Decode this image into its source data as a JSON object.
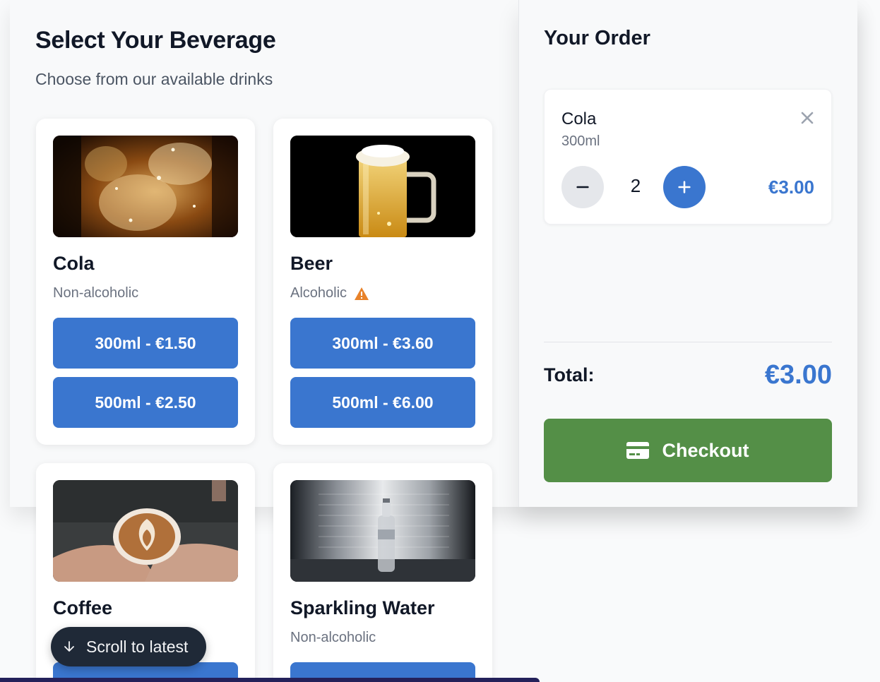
{
  "header": {
    "title": "Select Your Beverage",
    "subtitle": "Choose from our available drinks"
  },
  "beverages": [
    {
      "name": "Cola",
      "type": "Non-alcoholic",
      "options": [
        "300ml - €1.50",
        "500ml - €2.50"
      ],
      "image": "cola-photo"
    },
    {
      "name": "Beer",
      "type": "Alcoholic",
      "warning_icon": "warning-triangle-icon",
      "options": [
        "300ml - €3.60",
        "500ml - €6.00"
      ],
      "image": "beer-photo"
    },
    {
      "name": "Coffee",
      "image": "coffee-photo"
    },
    {
      "name": "Sparkling Water",
      "type": "Non-alcoholic",
      "image": "water-photo"
    }
  ],
  "order": {
    "title": "Your Order",
    "items": [
      {
        "name": "Cola",
        "size": "300ml",
        "quantity": "2",
        "price": "€3.00"
      }
    ],
    "total_label": "Total:",
    "total_value": "€3.00",
    "checkout_label": "Checkout"
  },
  "scroll_pill": {
    "label": "Scroll to latest"
  },
  "colors": {
    "primary": "#3a76cf",
    "checkout": "#548f47",
    "warning": "#e8822a"
  }
}
